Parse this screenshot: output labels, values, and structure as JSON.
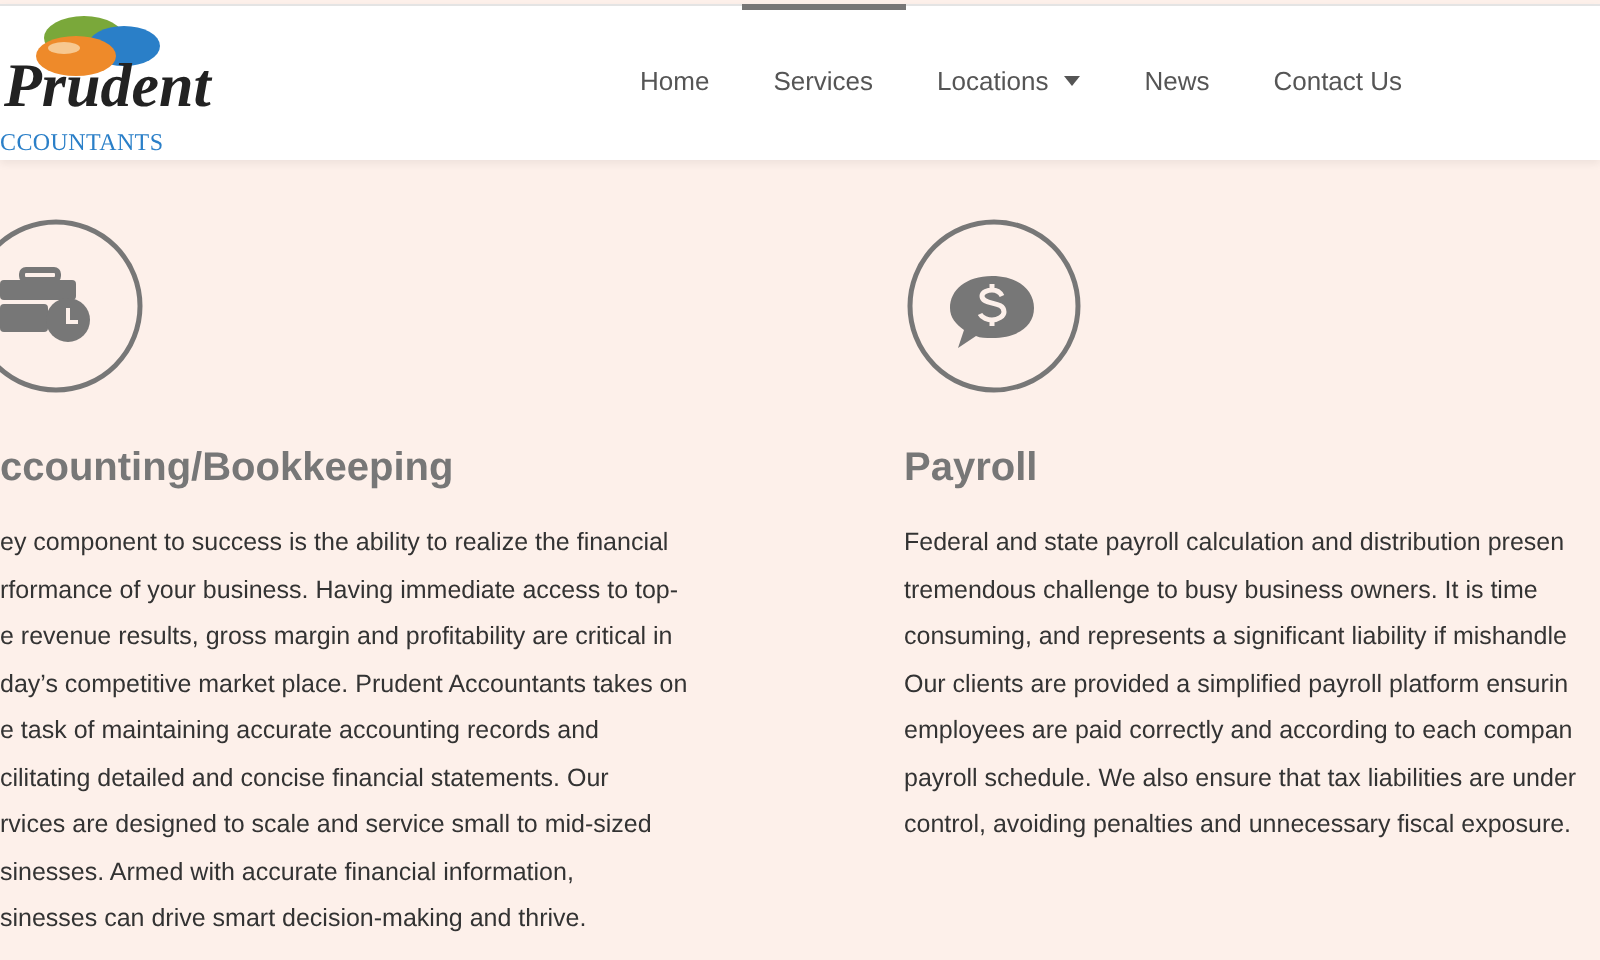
{
  "logo": {
    "name": "Prudent",
    "tagline": "CCOUNTANTS"
  },
  "nav": [
    {
      "label": "Home",
      "selected": false,
      "dropdown": false
    },
    {
      "label": "Services",
      "selected": true,
      "dropdown": false
    },
    {
      "label": "Locations",
      "selected": false,
      "dropdown": true
    },
    {
      "label": "News",
      "selected": false,
      "dropdown": false
    },
    {
      "label": "Contact Us",
      "selected": false,
      "dropdown": false
    }
  ],
  "services": [
    {
      "kind": "briefcase",
      "title": "ccounting/Bookkeeping",
      "lines": [
        "ey component to success is the ability to realize the financial",
        "rformance of your business. Having immediate access to top-",
        "e revenue results, gross margin and profitability are critical in",
        "day’s competitive market place. Prudent Accountants takes on",
        "e task of maintaining accurate accounting records and",
        "cilitating detailed and concise financial statements. Our",
        "rvices are designed to scale and service small to mid-sized",
        "sinesses. Armed with accurate financial information,",
        "sinesses can drive smart decision-making and thrive."
      ]
    },
    {
      "kind": "payroll",
      "title": "Payroll",
      "lines": [
        "Federal and state payroll calculation and distribution presen",
        "tremendous challenge to busy business owners. It is time",
        "consuming, and represents a significant liability if mishandle",
        "Our clients are provided a simplified payroll platform ensurin",
        "employees are paid correctly and according to each compan",
        "payroll schedule. We also ensure that tax liabilities are under",
        "control, avoiding penalties and unnecessary fiscal exposure."
      ]
    }
  ]
}
